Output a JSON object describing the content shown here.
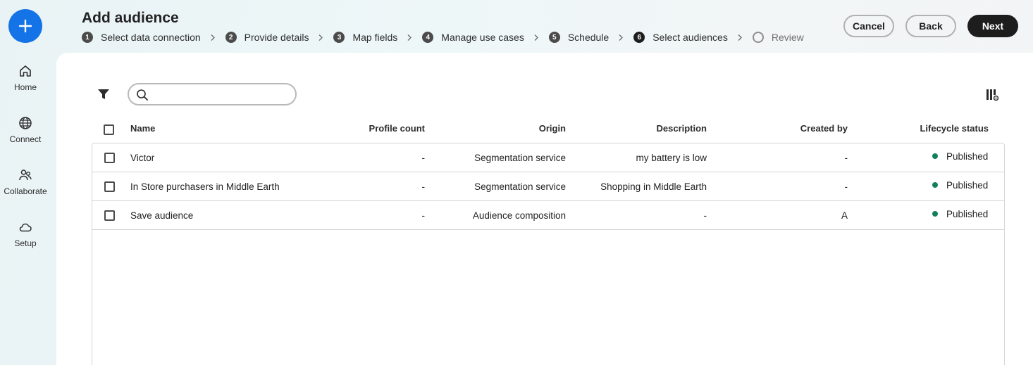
{
  "rail": {
    "items": [
      {
        "label": "Home",
        "icon": "home-icon"
      },
      {
        "label": "Connect",
        "icon": "globe-icon"
      },
      {
        "label": "Collaborate",
        "icon": "people-icon"
      },
      {
        "label": "Setup",
        "icon": "cloud-icon"
      }
    ],
    "accent": "#1473e6"
  },
  "header": {
    "title": "Add audience",
    "steps": [
      {
        "num": "1",
        "label": "Select data connection",
        "state": "done"
      },
      {
        "num": "2",
        "label": "Provide details",
        "state": "done"
      },
      {
        "num": "3",
        "label": "Map fields",
        "state": "done"
      },
      {
        "num": "4",
        "label": "Manage use cases",
        "state": "done"
      },
      {
        "num": "5",
        "label": "Schedule",
        "state": "done"
      },
      {
        "num": "6",
        "label": "Select audiences",
        "state": "current"
      },
      {
        "num": "",
        "label": "Review",
        "state": "pending"
      }
    ],
    "buttons": {
      "cancel": "Cancel",
      "back": "Back",
      "next": "Next"
    }
  },
  "toolbar": {
    "search_placeholder": ""
  },
  "table": {
    "columns": {
      "name": "Name",
      "profile_count": "Profile count",
      "origin": "Origin",
      "description": "Description",
      "created_by": "Created by",
      "lifecycle_status": "Lifecycle status"
    },
    "rows": [
      {
        "name": "Victor",
        "profile_count": "-",
        "origin": "Segmentation service",
        "description": "my battery is low",
        "created_by": "-",
        "status": "Published"
      },
      {
        "name": "In Store purchasers in Middle Earth",
        "profile_count": "-",
        "origin": "Segmentation service",
        "description": "Shopping in Middle Earth",
        "created_by": "-",
        "status": "Published"
      },
      {
        "name": "Save audience",
        "profile_count": "-",
        "origin": "Audience composition",
        "description": "-",
        "created_by": "A",
        "status": "Published"
      }
    ],
    "status_color": "#12805c"
  }
}
